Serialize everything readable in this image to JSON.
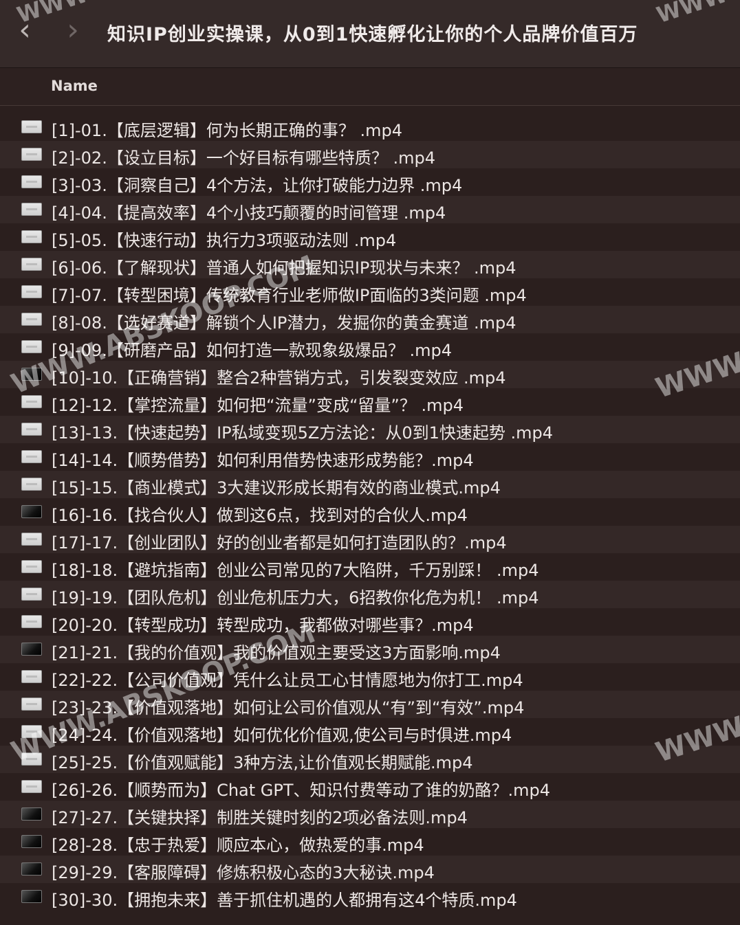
{
  "toolbar": {
    "title": "知识IP创业实操课，从0到1快速孵化让你的个人品牌价值百万",
    "back_icon": "‹",
    "forward_icon": "›"
  },
  "header": {
    "name": "Name"
  },
  "files": [
    {
      "name": "[1]-01.【底层逻辑】何为长期正确的事？ .mp4",
      "icon": "light"
    },
    {
      "name": "[2]-02.【设立目标】一个好目标有哪些特质？ .mp4",
      "icon": "light"
    },
    {
      "name": "[3]-03.【洞察自己】4个方法，让你打破能力边界 .mp4",
      "icon": "light"
    },
    {
      "name": "[4]-04.【提高效率】4个小技巧颠覆的时间管理 .mp4",
      "icon": "light"
    },
    {
      "name": "[5]-05.【快速行动】执行力3项驱动法则 .mp4",
      "icon": "light"
    },
    {
      "name": "[6]-06.【了解现状】普通人如何把握知识IP现状与未来？ .mp4",
      "icon": "light"
    },
    {
      "name": "[7]-07.【转型困境】传统教育行业老师做IP面临的3类问题 .mp4",
      "icon": "light"
    },
    {
      "name": "[8]-08.【选好赛道】解锁个人IP潜力，发掘你的黄金赛道 .mp4",
      "icon": "light"
    },
    {
      "name": "[9]-09.【研磨产品】如何打造一款现象级爆品？ .mp4",
      "icon": "light"
    },
    {
      "name": "[10]-10.【正确营销】整合2种营销方式，引发裂变效应 .mp4",
      "icon": "dark"
    },
    {
      "name": "[12]-12.【掌控流量】如何把“流量”变成“留量”？ .mp4",
      "icon": "light"
    },
    {
      "name": "[13]-13.【快速起势】IP私域变现5Z方法论：从0到1快速起势 .mp4",
      "icon": "light"
    },
    {
      "name": "[14]-14.【顺势借势】如何利用借势快速形成势能？.mp4",
      "icon": "light"
    },
    {
      "name": "[15]-15.【商业模式】3大建议形成长期有效的商业模式.mp4",
      "icon": "light"
    },
    {
      "name": "[16]-16.【找合伙人】做到这6点，找到对的合伙人.mp4",
      "icon": "dark"
    },
    {
      "name": "[17]-17.【创业团队】好的创业者都是如何打造团队的？.mp4",
      "icon": "light"
    },
    {
      "name": "[18]-18.【避坑指南】创业公司常见的7大陷阱，千万别踩！ .mp4",
      "icon": "light"
    },
    {
      "name": "[19]-19.【团队危机】创业危机压力大，6招教你化危为机！ .mp4",
      "icon": "light"
    },
    {
      "name": "[20]-20.【转型成功】转型成功，我都做对哪些事？.mp4",
      "icon": "light"
    },
    {
      "name": "[21]-21.【我的价值观】我的价值观主要受这3方面影响.mp4",
      "icon": "dark"
    },
    {
      "name": "[22]-22.【公司价值观】凭什么让员工心甘情愿地为你打工.mp4",
      "icon": "light"
    },
    {
      "name": "[23]-23.【价值观落地】如何让公司价值观从“有”到“有效”.mp4",
      "icon": "light"
    },
    {
      "name": "[24]-24.【价值观落地】如何优化价值观,使公司与时俱进.mp4",
      "icon": "light"
    },
    {
      "name": "[25]-25.【价值观赋能】3种方法,让价值观长期赋能.mp4",
      "icon": "light"
    },
    {
      "name": "[26]-26.【顺势而为】Chat GPT、知识付费等动了谁的奶酪？.mp4",
      "icon": "light"
    },
    {
      "name": "[27]-27.【关键抉择】制胜关键时刻的2项必备法则.mp4",
      "icon": "dark"
    },
    {
      "name": "[28]-28.【忠于热爱】顺应本心，做热爱的事.mp4",
      "icon": "dark"
    },
    {
      "name": "[29]-29.【客服障碍】修炼积极心态的3大秘诀.mp4",
      "icon": "dark"
    },
    {
      "name": "[30]-30.【拥抱未来】善于抓住机遇的人都拥有这4个特质.mp4",
      "icon": "dark"
    }
  ],
  "watermarks": {
    "text_site": "WWW.ABSKOOP.COM",
    "text_www": "WWW"
  }
}
